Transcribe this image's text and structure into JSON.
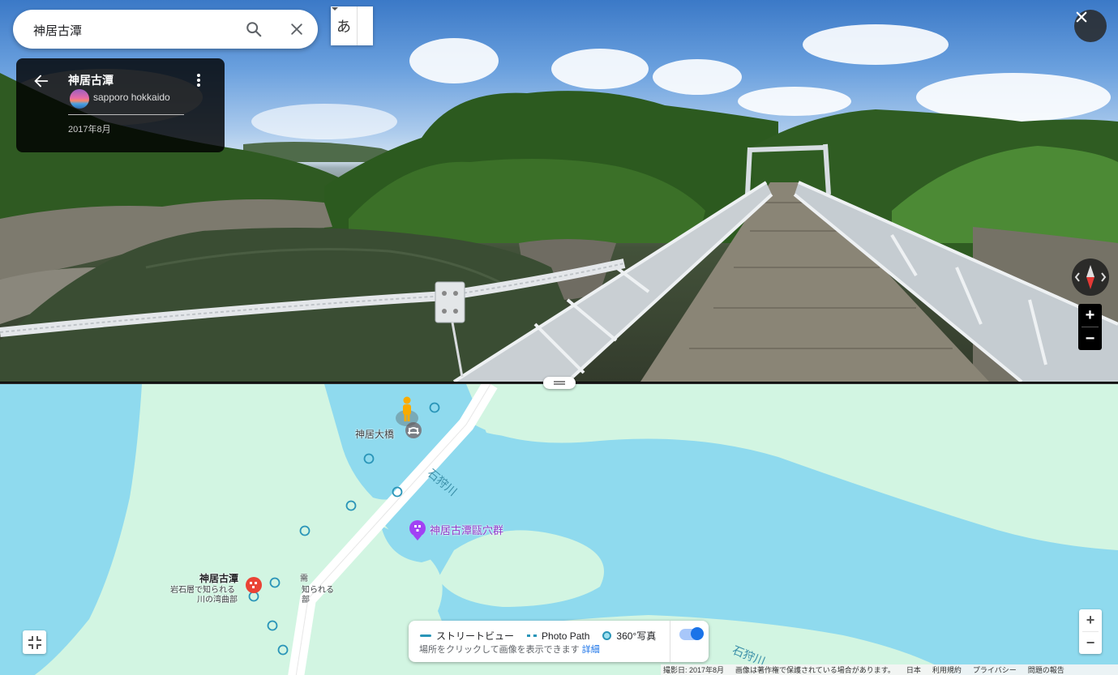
{
  "search": {
    "value": "神居古潭"
  },
  "ime": {
    "label": "あ"
  },
  "info_card": {
    "title": "神居古潭",
    "author": "sapporo hokkaido",
    "date": "2017年8月"
  },
  "map": {
    "labels": {
      "bridge": "神居大橋",
      "river1": "石狩川",
      "river2": "石狩川",
      "potholes": "神居古潭甌穴群",
      "place_title": "神居古潭",
      "place_desc1": "岩石層で知られる",
      "place_desc2": "川の湾曲部",
      "ghost1": "需",
      "ghost2": "知られる",
      "ghost3": "部"
    },
    "colors": {
      "water": "#8fdaee",
      "land": "#d2f5e2",
      "road": "#ffffff",
      "coverage": "#2a95b8"
    }
  },
  "legend": {
    "street_view": "ストリートビュー",
    "photo_path": "Photo Path",
    "photo360": "360°写真",
    "hint": "場所をクリックして画像を表示できます",
    "details_link": "詳細"
  },
  "footer": {
    "capture_date": "撮影日: 2017年8月",
    "copyright": "画像は著作権で保護されている場合があります。",
    "region": "日本",
    "terms": "利用規約",
    "privacy": "プライバシー",
    "report": "問題の報告"
  },
  "icons": {
    "search": "search-icon",
    "clear": "close-icon",
    "back": "arrow-back-icon",
    "menu": "more-vert-icon",
    "compass": "compass-icon",
    "pegman": "pegman-icon",
    "collapse": "collapse-icon"
  }
}
